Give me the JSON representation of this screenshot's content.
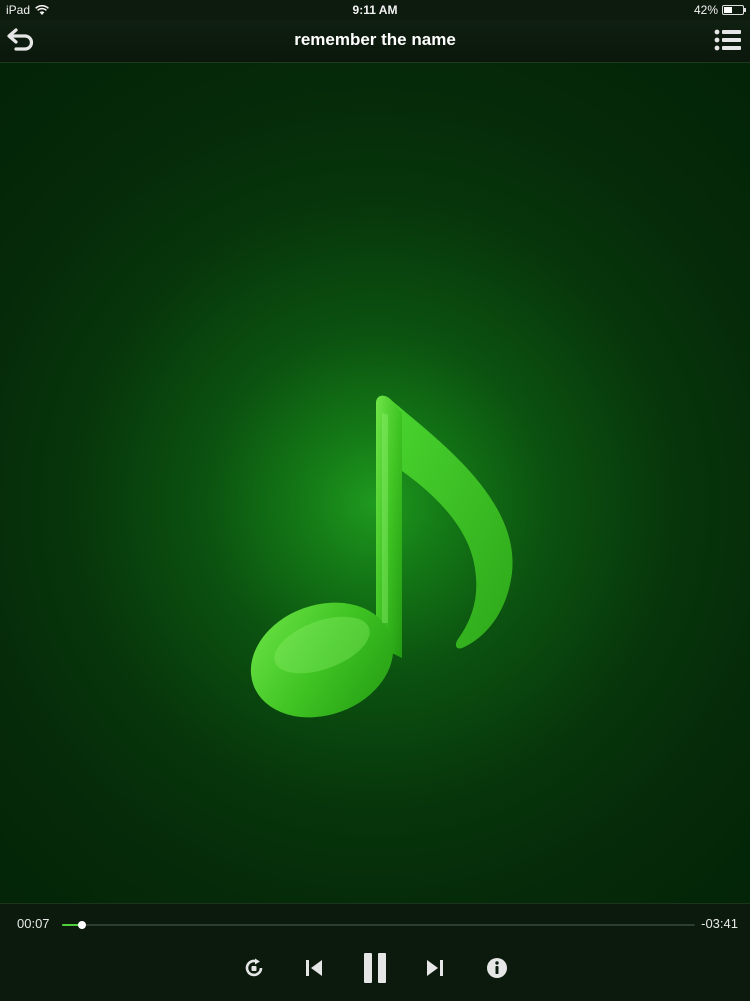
{
  "status_bar": {
    "device": "iPad",
    "time": "9:11 AM",
    "battery": "42%",
    "battery_level": 0.42,
    "wifi_icon": "wifi-icon",
    "battery_icon": "battery-icon"
  },
  "nav": {
    "title": "remember the name",
    "back_icon": "back-arrow-icon",
    "list_icon": "playlist-icon"
  },
  "artwork": {
    "icon": "music-note-icon",
    "accent": "#3fcf2a"
  },
  "player": {
    "elapsed": "00:07",
    "remaining": "-03:41",
    "progress": 0.032,
    "controls": [
      "repeat-icon",
      "previous-track-icon",
      "pause-icon",
      "next-track-icon",
      "info-icon"
    ]
  }
}
